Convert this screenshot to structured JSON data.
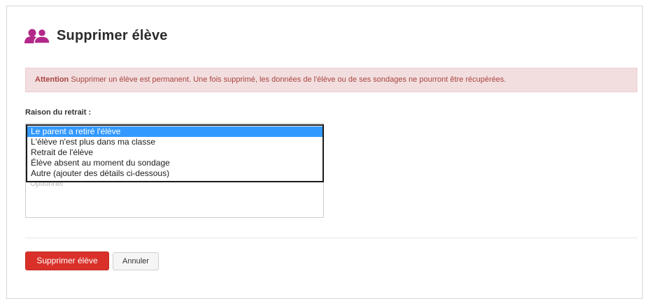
{
  "header": {
    "title": "Supprimer élève",
    "icon": "users-icon",
    "icon_color": "#b22888"
  },
  "alert": {
    "strong": "Attention",
    "message": "Supprimer un élève est permanent. Une fois supprimé, les données de l'élève ou de ses sondages ne pourront être récupérées."
  },
  "form": {
    "reason_label": "Raison du retrait :",
    "details_placeholder": "Optionnel",
    "options": [
      "Le parent a retiré l'élève",
      "L'élève n'est plus dans ma classe",
      "Retrait de l'élève",
      "Élève absent au moment du sondage",
      "Autre (ajouter des détails ci-dessous)"
    ],
    "selected_index": 0
  },
  "actions": {
    "delete_label": "Supprimer élève",
    "cancel_label": "Annuler",
    "delete_color": "#d9312a"
  }
}
